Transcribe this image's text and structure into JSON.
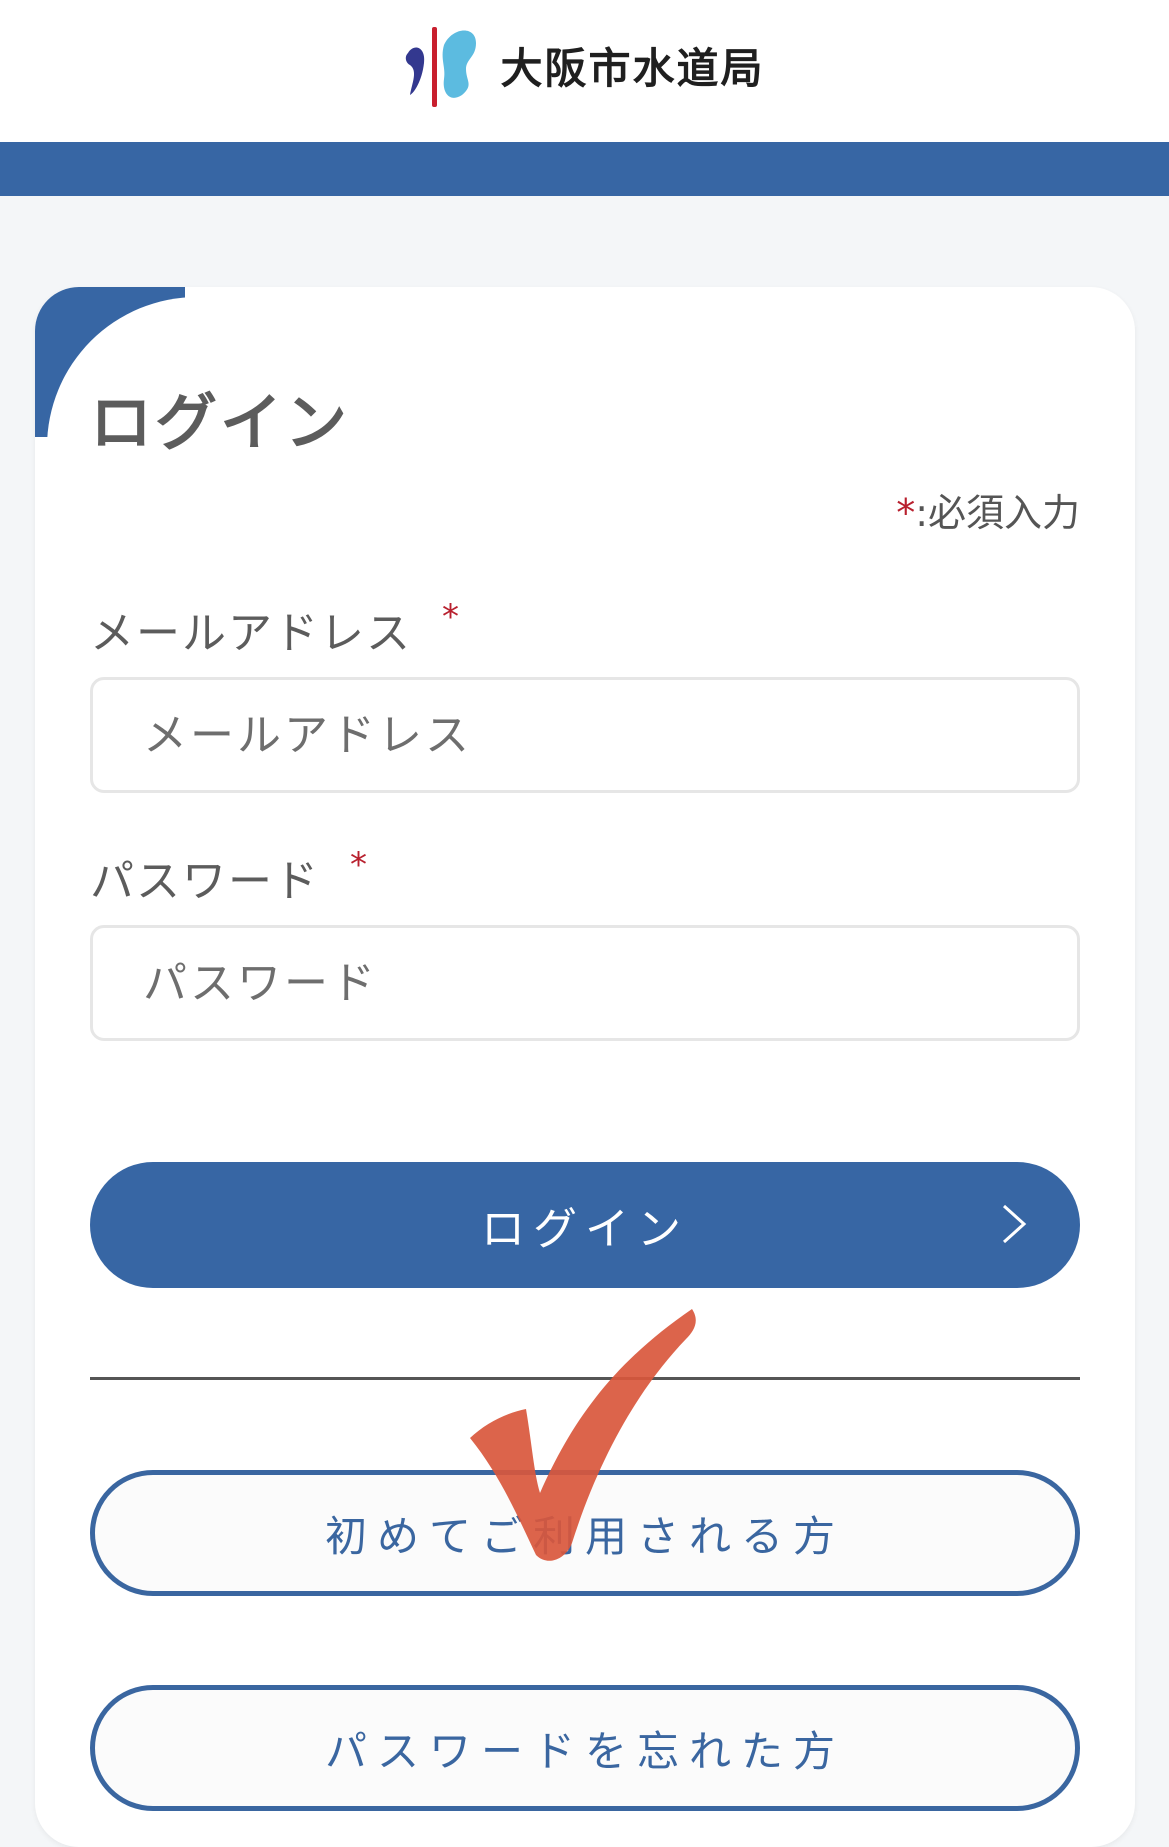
{
  "header": {
    "brand_name": "大阪市水道局",
    "band_color": "#3766a4"
  },
  "login_card": {
    "title": "ログイン",
    "required_note": {
      "marker": "*",
      "text": ":必須入力"
    },
    "email": {
      "label": "メールアドレス",
      "required_marker": "*",
      "placeholder": "メールアドレス",
      "value": ""
    },
    "password": {
      "label": "パスワード",
      "required_marker": "*",
      "placeholder": "パスワード",
      "value": ""
    },
    "login_button": {
      "label": "ログイン",
      "icon": "chevron-right-icon"
    },
    "first_time_button": {
      "label": "初めてご利用される方"
    },
    "forgot_password_button": {
      "label": "パスワードを忘れた方"
    }
  },
  "annotation": {
    "icon": "checkmark-icon",
    "color": "#d9573c"
  }
}
